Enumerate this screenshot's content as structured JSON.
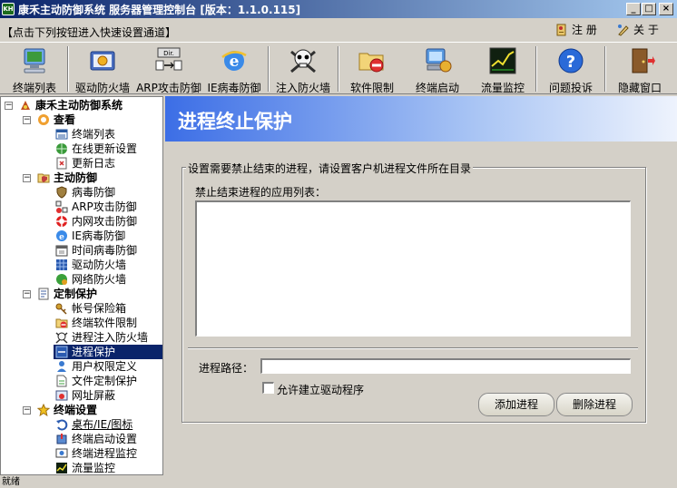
{
  "window": {
    "icon_text": "KH",
    "title": "康禾主动防御系统 服务器管理控制台 [版本：1.1.0.115]",
    "minimize": "_",
    "maximize": "□",
    "close": "×"
  },
  "hint_bar": {
    "hint": "【点击下列按钮进入快速设置通道】",
    "register_label": "注 册",
    "about_label": "关 于"
  },
  "toolbar": {
    "items": [
      {
        "label": "终端列表",
        "icon": "computer-icon"
      },
      {
        "label": "驱动防火墙",
        "icon": "firewall-icon"
      },
      {
        "label": "ARP攻击防御",
        "icon": "arp-icon"
      },
      {
        "label": "IE病毒防御",
        "icon": "ie-icon"
      },
      {
        "label": "注入防火墙",
        "icon": "skull-icon"
      },
      {
        "label": "软件限制",
        "icon": "folder-ban-icon"
      },
      {
        "label": "终端启动",
        "icon": "terminal-start-icon"
      },
      {
        "label": "流量监控",
        "icon": "chart-icon"
      },
      {
        "label": "问题投诉",
        "icon": "help-icon"
      },
      {
        "label": "隐藏窗口",
        "icon": "exit-door-icon"
      }
    ]
  },
  "tree": {
    "root": "康禾主动防御系统",
    "groups": [
      {
        "label": "查看",
        "items": [
          "终端列表",
          "在线更新设置",
          "更新日志"
        ]
      },
      {
        "label": "主动防御",
        "items": [
          "病毒防御",
          "ARP攻击防御",
          "内网攻击防御",
          "IE病毒防御",
          "时间病毒防御",
          "驱动防火墙",
          "网络防火墙"
        ]
      },
      {
        "label": "定制保护",
        "items": [
          "帐号保险箱",
          "终端软件限制",
          "进程注入防火墙",
          "进程保护",
          "用户权限定义",
          "文件定制保护",
          "网址屏蔽"
        ]
      },
      {
        "label": "终端设置",
        "items": [
          "桌布/IE/图标",
          "终端启动设置",
          "终端进程监控",
          "流量监控"
        ]
      }
    ],
    "selected": "进程保护"
  },
  "panel": {
    "title": "进程终止保护",
    "group_legend": "设置需要禁止结束的进程，请设置客户机进程文件所在目录",
    "list_label": "禁止结束进程的应用列表：",
    "path_label": "进程路径：",
    "path_value": "",
    "checkbox_label": "允许建立驱动程序",
    "checkbox_checked": false,
    "add_button": "添加进程",
    "delete_button": "删除进程"
  },
  "status": {
    "text": "就绪"
  },
  "colors": {
    "title_bar": "#0a246a",
    "header_gradient_start": "#3c6ee6",
    "selection": "#0a246a",
    "face": "#d4d0c8"
  }
}
